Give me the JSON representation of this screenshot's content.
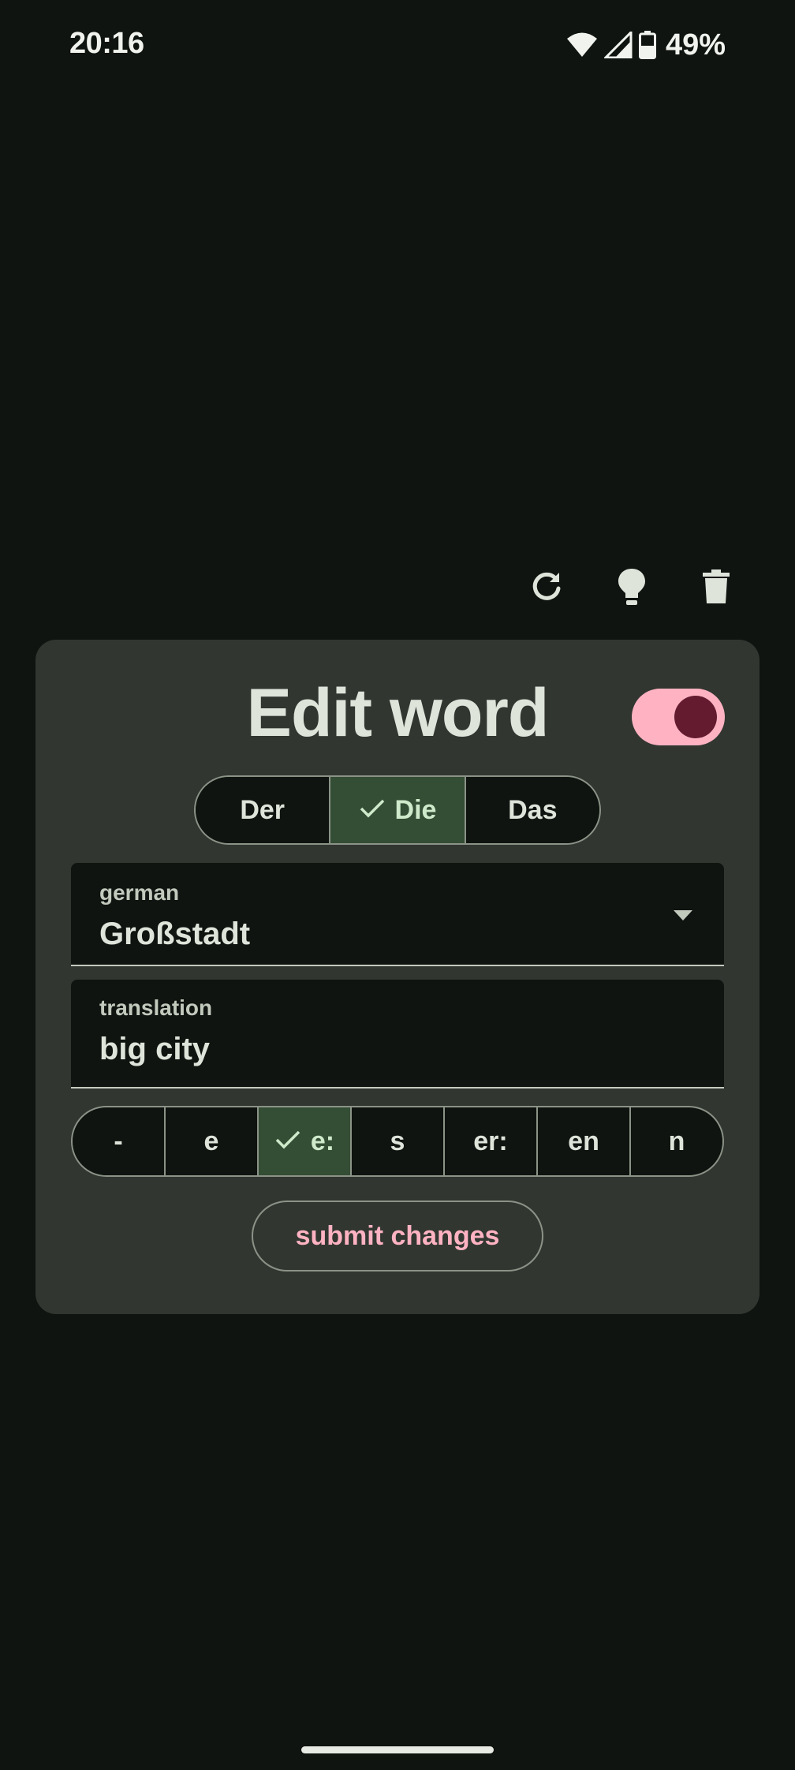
{
  "status_bar": {
    "time": "20:16",
    "battery_percent": "49%",
    "icons": [
      "wifi-icon",
      "signal-icon",
      "battery-icon"
    ]
  },
  "toolbar": {
    "icons": [
      "refresh-icon",
      "lightbulb-icon",
      "trash-icon"
    ]
  },
  "card": {
    "title": "Edit word",
    "toggle_on": true,
    "articles": [
      {
        "label": "Der",
        "selected": false
      },
      {
        "label": "Die",
        "selected": true
      },
      {
        "label": "Das",
        "selected": false
      }
    ],
    "german_field": {
      "label": "german",
      "value": "Großstadt"
    },
    "translation_field": {
      "label": "translation",
      "value": "big city"
    },
    "plurals": [
      {
        "label": "-",
        "selected": false
      },
      {
        "label": "e",
        "selected": false
      },
      {
        "label": "e:",
        "selected": true
      },
      {
        "label": "s",
        "selected": false
      },
      {
        "label": "er:",
        "selected": false
      },
      {
        "label": "en",
        "selected": false
      },
      {
        "label": "n",
        "selected": false
      }
    ],
    "submit_label": "submit changes"
  },
  "colors": {
    "background": "#0f1410",
    "card": "#323631",
    "accent_pink": "#ffb3c2",
    "selected_green": "#344d35"
  }
}
